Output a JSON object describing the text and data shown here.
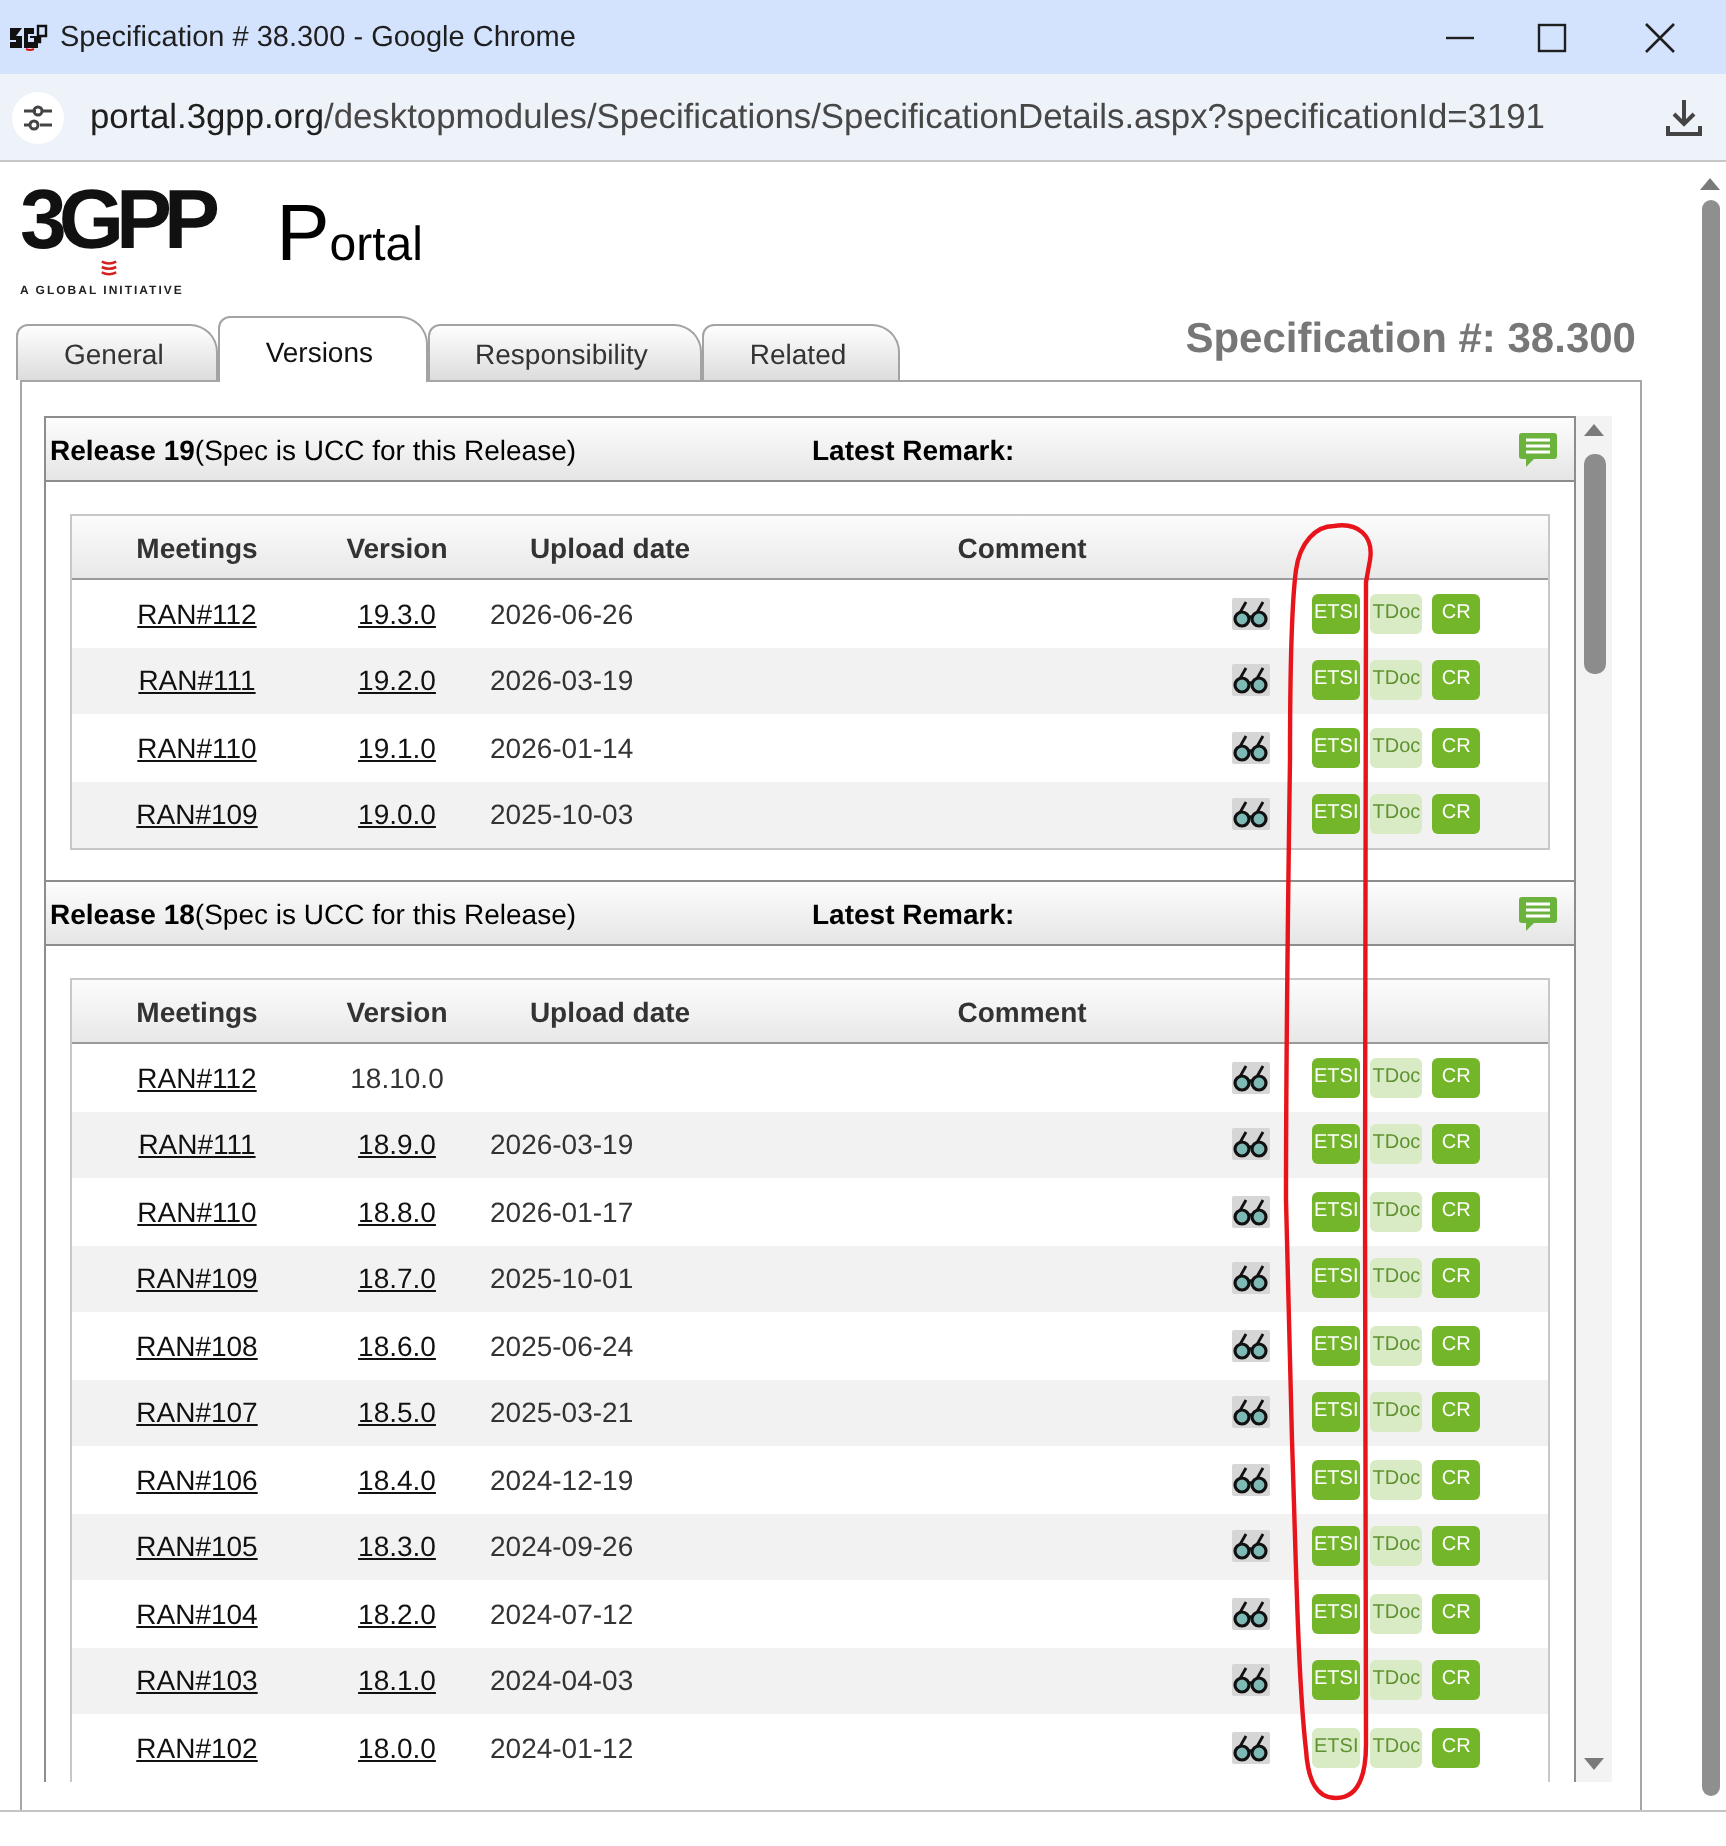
{
  "window": {
    "title": "Specification # 38.300 - Google Chrome"
  },
  "address_bar": {
    "host": "portal.3gpp.org",
    "path": "/desktopmodules/Specifications/SpecificationDetails.aspx?specificationId=3191"
  },
  "logo": {
    "wordmark": "3GPP",
    "tagline": "A GLOBAL INITIATIVE"
  },
  "portal_title": "Portal",
  "tabs": [
    {
      "label": "General",
      "selected": false
    },
    {
      "label": "Versions",
      "selected": true
    },
    {
      "label": "Responsibility",
      "selected": false
    },
    {
      "label": "Related",
      "selected": false
    }
  ],
  "spec_number": "Specification #: 38.300",
  "releases": [
    {
      "title": "**Release 19**(Spec is UCC for this Release)",
      "remark_label": "Latest Remark:",
      "columns": [
        "Meetings",
        "Version",
        "Upload date",
        "Comment"
      ],
      "rows": [
        {
          "meeting": "RAN#112",
          "version": {
            "text": "19.3.0",
            "linked": true
          },
          "upload_date": "2026-06-26",
          "buttons": [
            {
              "label": "ETSI",
              "disabled": false
            },
            {
              "label": "TDoc",
              "disabled": true
            },
            {
              "label": "CR",
              "disabled": false
            }
          ]
        },
        {
          "meeting": "RAN#111",
          "version": {
            "text": "19.2.0",
            "linked": true
          },
          "upload_date": "2026-03-19",
          "buttons": [
            {
              "label": "ETSI",
              "disabled": false
            },
            {
              "label": "TDoc",
              "disabled": true
            },
            {
              "label": "CR",
              "disabled": false
            }
          ]
        },
        {
          "meeting": "RAN#110",
          "version": {
            "text": "19.1.0",
            "linked": true
          },
          "upload_date": "2026-01-14",
          "buttons": [
            {
              "label": "ETSI",
              "disabled": false
            },
            {
              "label": "TDoc",
              "disabled": true
            },
            {
              "label": "CR",
              "disabled": false
            }
          ]
        },
        {
          "meeting": "RAN#109",
          "version": {
            "text": "19.0.0",
            "linked": true
          },
          "upload_date": "2025-10-03",
          "buttons": [
            {
              "label": "ETSI",
              "disabled": false
            },
            {
              "label": "TDoc",
              "disabled": true
            },
            {
              "label": "CR",
              "disabled": false
            }
          ]
        }
      ]
    },
    {
      "title": "**Release 18**(Spec is UCC for this Release)",
      "remark_label": "Latest Remark:",
      "columns": [
        "Meetings",
        "Version",
        "Upload date",
        "Comment"
      ],
      "rows": [
        {
          "meeting": "RAN#112",
          "version": {
            "text": "18.10.0",
            "linked": false
          },
          "buttons": [
            {
              "label": "ETSI",
              "disabled": false
            },
            {
              "label": "TDoc",
              "disabled": true
            },
            {
              "label": "CR",
              "disabled": false
            }
          ]
        },
        {
          "meeting": "RAN#111",
          "version": {
            "text": "18.9.0",
            "linked": true
          },
          "upload_date": "2026-03-19",
          "buttons": [
            {
              "label": "ETSI",
              "disabled": false
            },
            {
              "label": "TDoc",
              "disabled": true
            },
            {
              "label": "CR",
              "disabled": false
            }
          ]
        },
        {
          "meeting": "RAN#110",
          "version": {
            "text": "18.8.0",
            "linked": true
          },
          "upload_date": "2026-01-17",
          "buttons": [
            {
              "label": "ETSI",
              "disabled": false
            },
            {
              "label": "TDoc",
              "disabled": true
            },
            {
              "label": "CR",
              "disabled": false
            }
          ]
        },
        {
          "meeting": "RAN#109",
          "version": {
            "text": "18.7.0",
            "linked": true
          },
          "upload_date": "2025-10-01",
          "buttons": [
            {
              "label": "ETSI",
              "disabled": false
            },
            {
              "label": "TDoc",
              "disabled": true
            },
            {
              "label": "CR",
              "disabled": false
            }
          ]
        },
        {
          "meeting": "RAN#108",
          "version": {
            "text": "18.6.0",
            "linked": true
          },
          "upload_date": "2025-06-24",
          "buttons": [
            {
              "label": "ETSI",
              "disabled": false
            },
            {
              "label": "TDoc",
              "disabled": true
            },
            {
              "label": "CR",
              "disabled": false
            }
          ]
        },
        {
          "meeting": "RAN#107",
          "version": {
            "text": "18.5.0",
            "linked": true
          },
          "upload_date": "2025-03-21",
          "buttons": [
            {
              "label": "ETSI",
              "disabled": false
            },
            {
              "label": "TDoc",
              "disabled": true
            },
            {
              "label": "CR",
              "disabled": false
            }
          ]
        },
        {
          "meeting": "RAN#106",
          "version": {
            "text": "18.4.0",
            "linked": true
          },
          "upload_date": "2024-12-19",
          "buttons": [
            {
              "label": "ETSI",
              "disabled": false
            },
            {
              "label": "TDoc",
              "disabled": true
            },
            {
              "label": "CR",
              "disabled": false
            }
          ]
        },
        {
          "meeting": "RAN#105",
          "version": {
            "text": "18.3.0",
            "linked": true
          },
          "upload_date": "2024-09-26",
          "buttons": [
            {
              "label": "ETSI",
              "disabled": false
            },
            {
              "label": "TDoc",
              "disabled": true
            },
            {
              "label": "CR",
              "disabled": false
            }
          ]
        },
        {
          "meeting": "RAN#104",
          "version": {
            "text": "18.2.0",
            "linked": true
          },
          "upload_date": "2024-07-12",
          "buttons": [
            {
              "label": "ETSI",
              "disabled": false
            },
            {
              "label": "TDoc",
              "disabled": true
            },
            {
              "label": "CR",
              "disabled": false
            }
          ]
        },
        {
          "meeting": "RAN#103",
          "version": {
            "text": "18.1.0",
            "linked": true
          },
          "upload_date": "2024-04-03",
          "buttons": [
            {
              "label": "ETSI",
              "disabled": false
            },
            {
              "label": "TDoc",
              "disabled": true
            },
            {
              "label": "CR",
              "disabled": false
            }
          ]
        },
        {
          "meeting": "RAN#102",
          "version": {
            "text": "18.0.0",
            "linked": true
          },
          "upload_date": "2024-01-12",
          "buttons": [
            {
              "label": "ETSI",
              "disabled": true
            },
            {
              "label": "TDoc",
              "disabled": true
            },
            {
              "label": "CR",
              "disabled": false
            }
          ]
        }
      ]
    }
  ]
}
